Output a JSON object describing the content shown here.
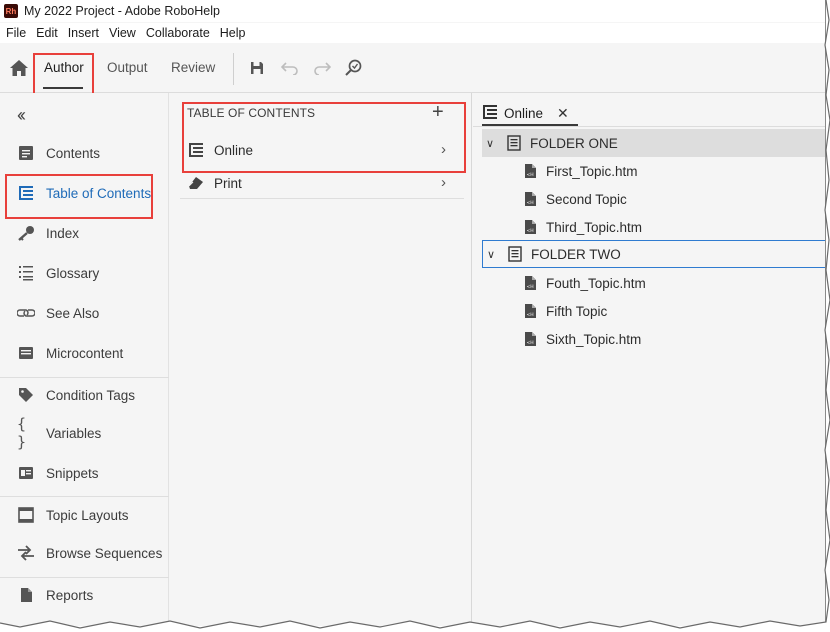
{
  "window": {
    "title": "My 2022 Project - Adobe RoboHelp",
    "app_badge": "Rh"
  },
  "menu": [
    "File",
    "Edit",
    "Insert",
    "View",
    "Collaborate",
    "Help"
  ],
  "toolbar": {
    "tabs": [
      "Author",
      "Output",
      "Review"
    ],
    "active_tab": "Author",
    "icons": [
      "home-icon",
      "save-icon",
      "undo-icon",
      "redo-icon",
      "find-replace-icon"
    ]
  },
  "rail": {
    "collapse_icon": "double-chevron-left-icon",
    "items": [
      {
        "label": "Contents",
        "icon": "contents-icon"
      },
      {
        "label": "Table of Contents",
        "icon": "toc-icon",
        "active": true
      },
      {
        "label": "Index",
        "icon": "key-icon"
      },
      {
        "label": "Glossary",
        "icon": "list-icon"
      },
      {
        "label": "See Also",
        "icon": "link-icon"
      },
      {
        "label": "Microcontent",
        "icon": "microcontent-icon"
      },
      {
        "label": "Condition Tags",
        "icon": "tag-icon"
      },
      {
        "label": "Variables",
        "icon": "braces-icon"
      },
      {
        "label": "Snippets",
        "icon": "snippet-icon"
      },
      {
        "label": "Topic Layouts",
        "icon": "layout-icon"
      },
      {
        "label": "Browse Sequences",
        "icon": "arrows-icon"
      },
      {
        "label": "Reports",
        "icon": "report-icon"
      }
    ],
    "active_color": "#1f6bb8"
  },
  "toc_panel": {
    "header": "TABLE OF CONTENTS",
    "rows": [
      {
        "label": "Online",
        "icon": "toc-icon"
      },
      {
        "label": "Print",
        "icon": "eraser-icon"
      }
    ]
  },
  "editor": {
    "tab_label": "Online",
    "tree": [
      {
        "label": "FOLDER ONE",
        "kind": "folder"
      },
      {
        "label": "First_Topic.htm",
        "kind": "topic"
      },
      {
        "label": "Second Topic",
        "kind": "topic"
      },
      {
        "label": "Third_Topic.htm",
        "kind": "topic"
      },
      {
        "label": "FOLDER TWO",
        "kind": "folder"
      },
      {
        "label": "Fouth_Topic.htm",
        "kind": "topic"
      },
      {
        "label": "Fifth Topic",
        "kind": "topic"
      },
      {
        "label": "Sixth_Topic.htm",
        "kind": "topic"
      }
    ]
  },
  "colors": {
    "highlight_box": "#e8403b",
    "selection": "#2f7bd0"
  }
}
